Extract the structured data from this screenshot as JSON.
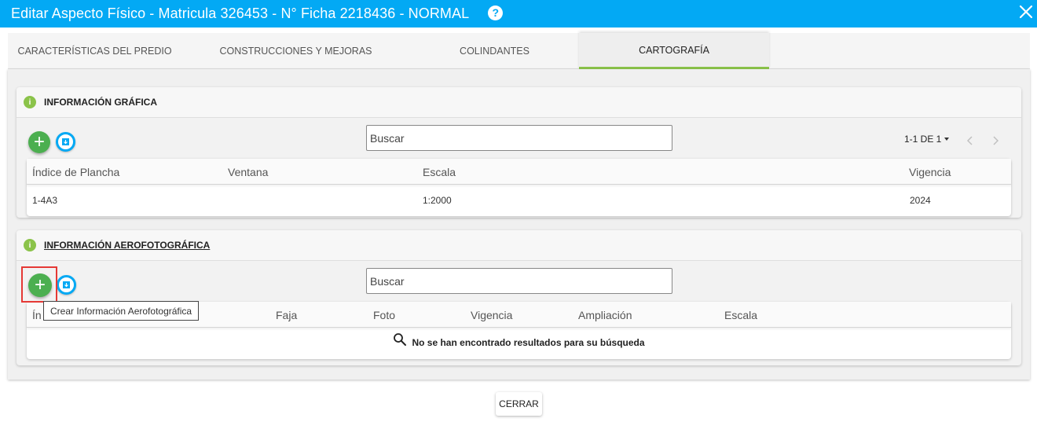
{
  "dialog": {
    "title": "Editar Aspecto Físico - Matricula 326453 - N° Ficha 2218436 - NORMAL",
    "help_icon": "?",
    "close_icon": "close-icon"
  },
  "tabs": [
    {
      "label": "CARACTERÍSTICAS DEL PREDIO",
      "active": false
    },
    {
      "label": "CONSTRUCCIONES Y MEJORAS",
      "active": false
    },
    {
      "label": "COLINDANTES",
      "active": false
    },
    {
      "label": "CARTOGRAFÍA",
      "active": true
    }
  ],
  "grafica": {
    "info_icon": "i",
    "title": "INFORMACIÓN GRÁFICA",
    "add_icon": "+",
    "search_placeholder": "Buscar",
    "pager": "1-1 DE 1",
    "columns": [
      "Índice de Plancha",
      "Ventana",
      "Escala",
      "Vigencia"
    ],
    "rows": [
      {
        "indice": "1-4A3",
        "ventana": "",
        "escala": "1:2000",
        "vigencia": "2024"
      }
    ]
  },
  "aero": {
    "info_icon": "i",
    "title": "INFORMACIÓN AEROFOTOGRÁFICA",
    "add_icon": "+",
    "search_placeholder": "Buscar",
    "columns": [
      "Ín",
      "Faja",
      "Foto",
      "Vigencia",
      "Ampliación",
      "Escala"
    ],
    "empty_message": "No se han encontrado resultados para su búsqueda",
    "tooltip": "Crear Información Aerofotográfica"
  },
  "footer": {
    "close_label": "CERRAR"
  },
  "colors": {
    "header": "#03a9f4",
    "accent_green": "#8bc34a",
    "add_button": "#4caf50",
    "highlight": "#e53935"
  }
}
